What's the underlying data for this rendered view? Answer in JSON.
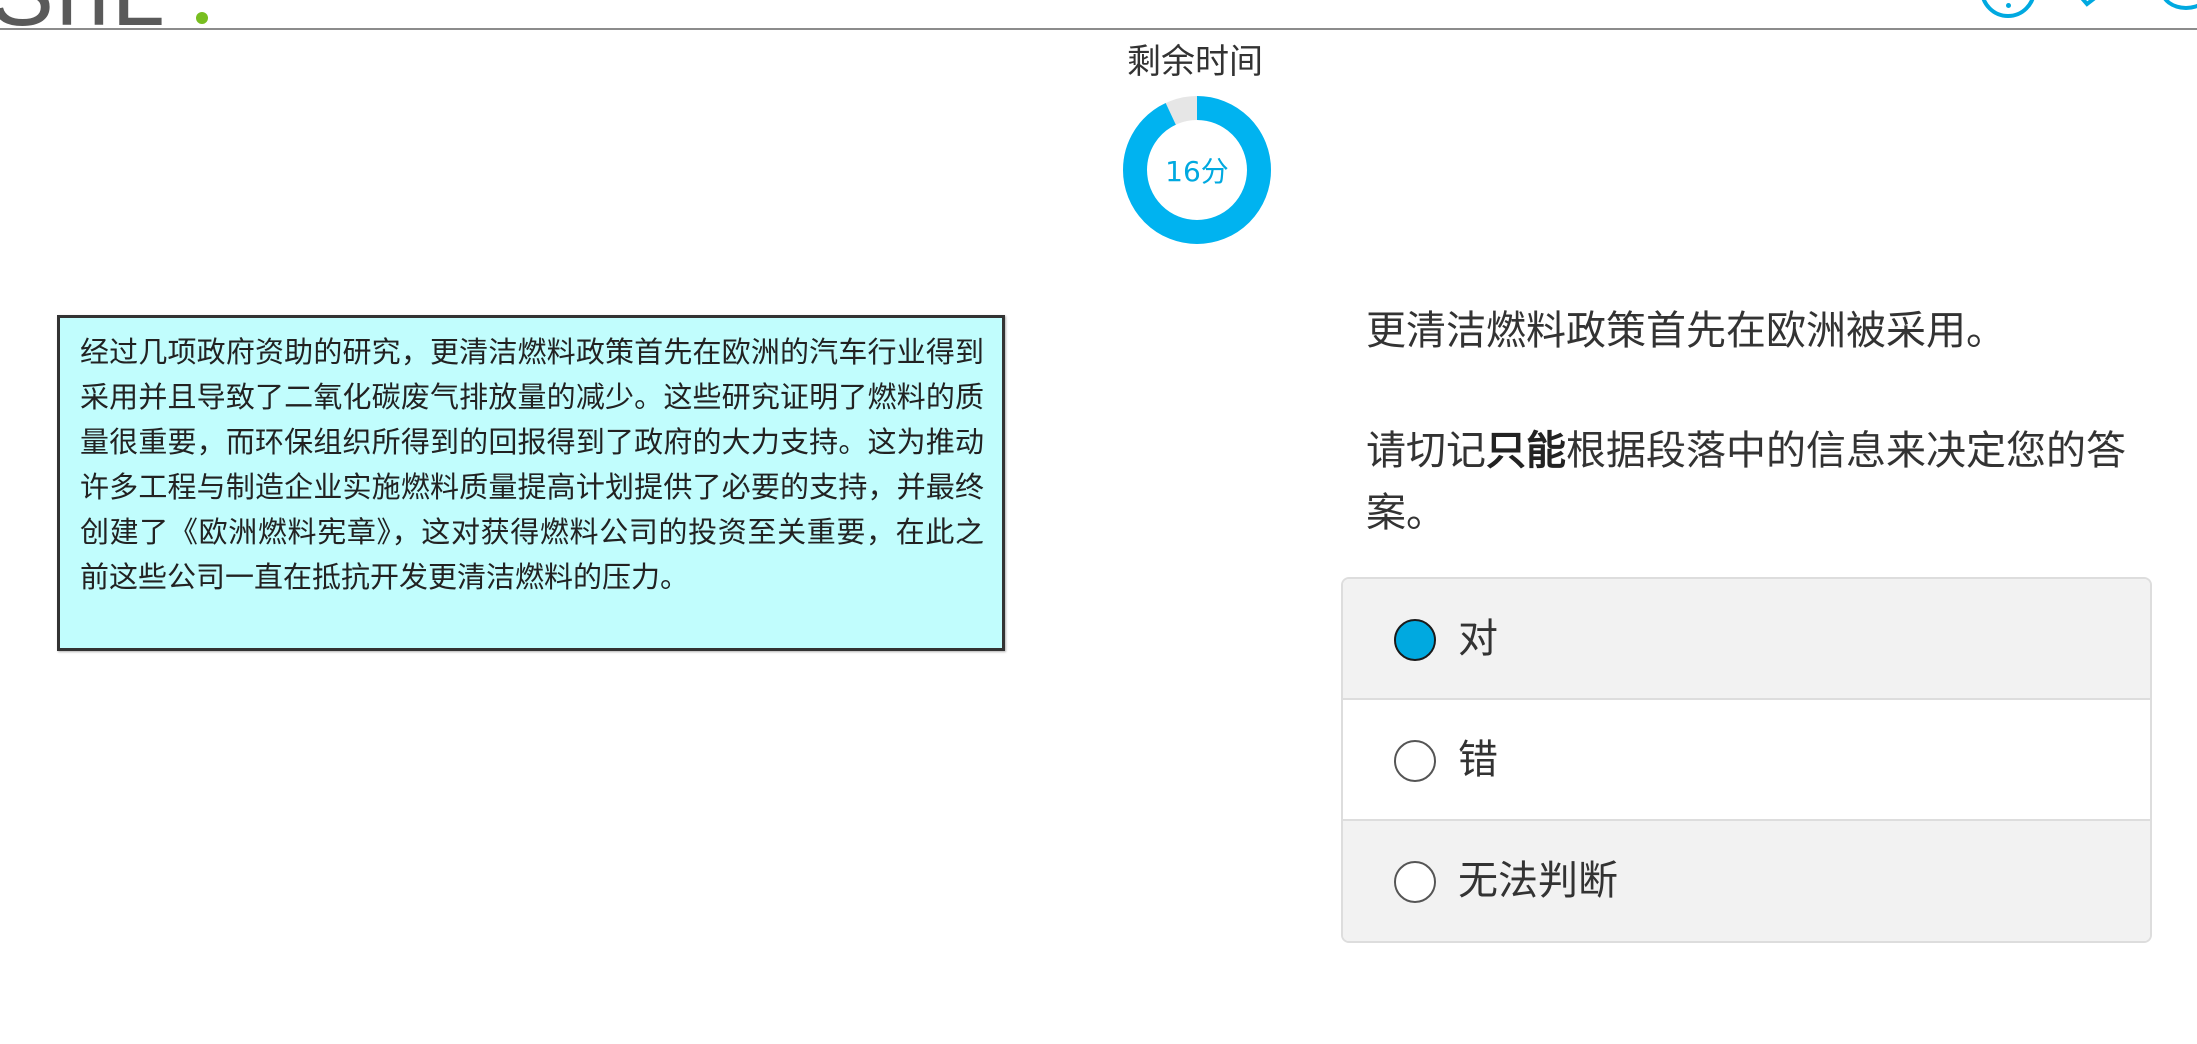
{
  "header": {
    "brand_text": "ShL",
    "help_icon": "help-circle-icon",
    "check_icon": "checkmark-icon",
    "edge_icon": "circle-icon",
    "accent_color": "#00a9e0",
    "brand_dot_color": "#78be20"
  },
  "timer": {
    "label": "剩余时间",
    "value": "16分",
    "remaining_fraction": 0.93,
    "ring_color": "#00b3f0",
    "track_color": "#e6e6e6"
  },
  "passage": {
    "text": "经过几项政府资助的研究，更清洁燃料政策首先在欧洲的汽车行业得到采用并且导致了二氧化碳废气排放量的减少。这些研究证明了燃料的质量很重要，而环保组织所得到的回报得到了政府的大力支持。这为推动许多工程与制造企业实施燃料质量提高计划提供了必要的支持，并最终创建了《欧洲燃料宪章》，这对获得燃料公司的投资至关重要，在此之前这些公司一直在抵抗开发更清洁燃料的压力。",
    "background_color": "#c1fdfd"
  },
  "question": {
    "statement": "更清洁燃料政策首先在欧洲被采用。",
    "instruction_before": "请切记",
    "instruction_bold": "只能",
    "instruction_after": "根据段落中的信息来决定您的答案。"
  },
  "options": [
    {
      "label": "对",
      "selected": true
    },
    {
      "label": "错",
      "selected": false
    },
    {
      "label": "无法判断",
      "selected": false
    }
  ]
}
